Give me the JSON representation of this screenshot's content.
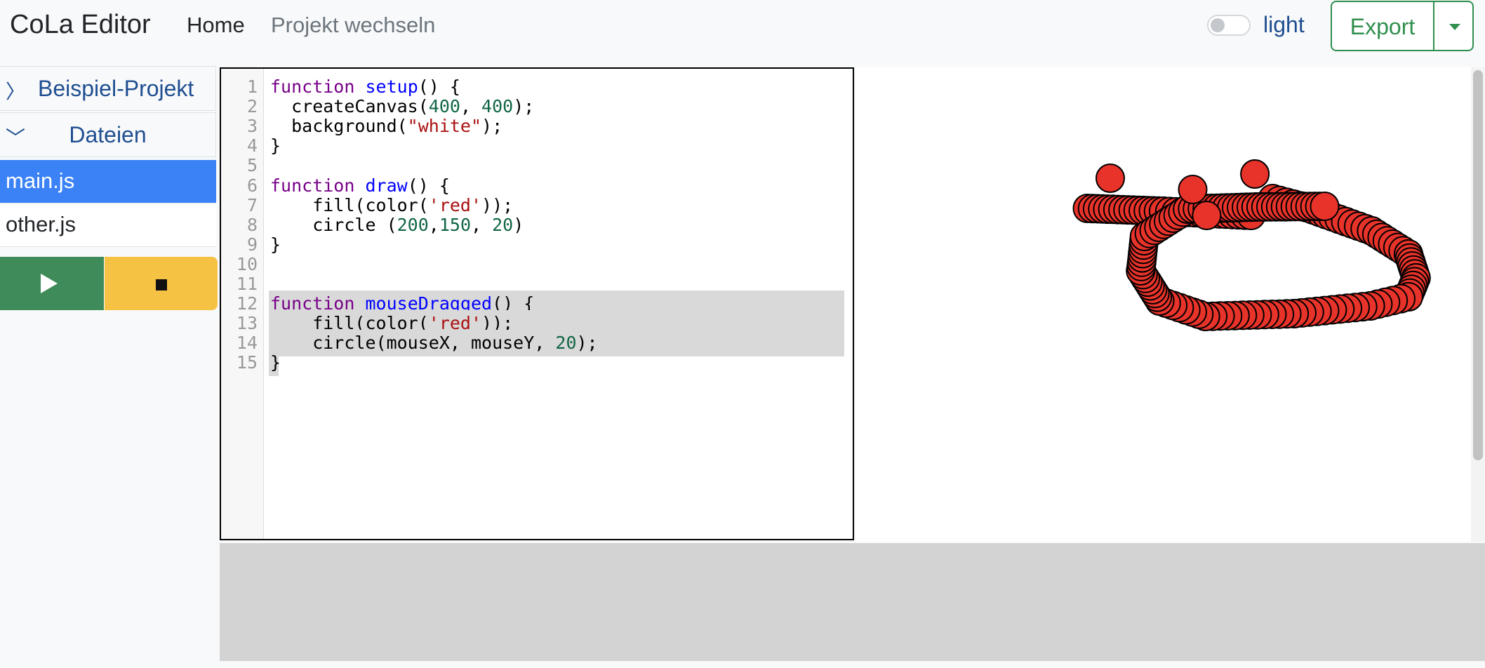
{
  "navbar": {
    "brand": "CoLa Editor",
    "home": "Home",
    "switch_project": "Projekt wechseln",
    "theme_label": "light",
    "export_label": "Export"
  },
  "sidebar": {
    "project_name": "Beispiel-Projekt",
    "files_header": "Dateien",
    "project_chevron": "〉",
    "files_chevron": "﹀",
    "files": [
      {
        "name": "main.js",
        "active": true
      },
      {
        "name": "other.js",
        "active": false
      }
    ],
    "run_icon": "play-icon",
    "stop_icon": "stop-icon"
  },
  "editor": {
    "file": "main.js",
    "line_numbers": [
      "1",
      "2",
      "3",
      "4",
      "5",
      "6",
      "7",
      "8",
      "9",
      "10",
      "11",
      "12",
      "13",
      "14",
      "15"
    ],
    "lines": [
      "function setup() {",
      "  createCanvas(400, 400);",
      "  background(\"white\");",
      "}",
      "",
      "function draw() {",
      "    fill(color('red'));",
      "    circle (200,150, 20)",
      "}",
      "",
      "",
      "function mouseDragged() {",
      "    fill(color('red'));",
      "    circle(mouseX, mouseY, 20);",
      "}"
    ],
    "selected_lines": [
      12,
      13,
      14,
      15
    ]
  },
  "colors": {
    "accent_blue": "#3b82f6",
    "run_green": "#3f8b59",
    "stop_yellow": "#f6c244",
    "export_green": "#2f8f4e",
    "circle_fill": "#e8332a"
  }
}
